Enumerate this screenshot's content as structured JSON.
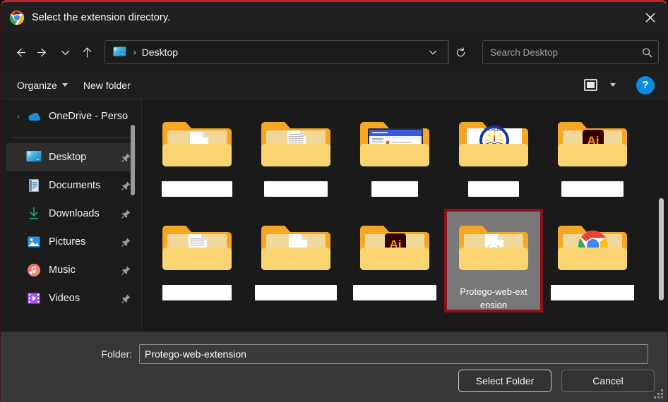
{
  "window": {
    "title": "Select the extension directory.",
    "app_icon": "chrome-icon",
    "close_label": "×",
    "accent_border": "#c0272d"
  },
  "nav": {
    "back": "back-arrow",
    "forward": "forward-arrow",
    "recent": "chevron-down",
    "up": "up-arrow",
    "refresh": "refresh-icon",
    "address": {
      "icon": "desktop-icon",
      "separator": "›",
      "crumb": "Desktop",
      "dropdown": "chevron-down"
    },
    "search": {
      "placeholder": "Search Desktop",
      "value": "",
      "icon": "search-icon"
    }
  },
  "command_bar": {
    "organize": "Organize",
    "new_folder": "New folder",
    "view_icon": "large-icons-view-icon",
    "view_caret": "chevron-down-icon",
    "help": "?"
  },
  "sidebar": {
    "tree_items": [
      {
        "label": "OneDrive - Perso",
        "icon": "onedrive-icon",
        "expander": "›",
        "pinned": false,
        "selected": false
      }
    ],
    "quick_access": [
      {
        "label": "Desktop",
        "icon": "desktop-icon",
        "pinned": true,
        "selected": true
      },
      {
        "label": "Documents",
        "icon": "documents-icon",
        "pinned": true,
        "selected": false
      },
      {
        "label": "Downloads",
        "icon": "downloads-icon",
        "pinned": true,
        "selected": false
      },
      {
        "label": "Pictures",
        "icon": "pictures-icon",
        "pinned": true,
        "selected": false
      },
      {
        "label": "Music",
        "icon": "music-icon",
        "pinned": true,
        "selected": false
      },
      {
        "label": "Videos",
        "icon": "videos-icon",
        "pinned": true,
        "selected": false
      }
    ]
  },
  "file_grid": {
    "items": [
      {
        "label": "",
        "redacted": true,
        "width_class": "w1",
        "icon": "folder-doc-icon",
        "selected": false
      },
      {
        "label": "",
        "redacted": true,
        "width_class": "w2",
        "icon": "folder-lines-icon",
        "selected": false
      },
      {
        "label": "",
        "redacted": true,
        "width_class": "w3",
        "icon": "folder-browser-icon",
        "selected": false
      },
      {
        "label": "",
        "redacted": true,
        "width_class": "w4",
        "icon": "folder-school-icon",
        "selected": false
      },
      {
        "label": "",
        "redacted": true,
        "width_class": "w5",
        "icon": "folder-ai-icon",
        "selected": false
      },
      {
        "label": "",
        "redacted": true,
        "width_class": "w6",
        "icon": "folder-lines-red-icon",
        "selected": false
      },
      {
        "label": "",
        "redacted": true,
        "width_class": "w7",
        "icon": "folder-doc-icon",
        "selected": false
      },
      {
        "label": "",
        "redacted": true,
        "width_class": "w8",
        "icon": "folder-ai-icon",
        "selected": false
      },
      {
        "label": "Protego-web-extension",
        "redacted": false,
        "width_class": "",
        "icon": "folder-code-icon",
        "selected": true
      },
      {
        "label": "",
        "redacted": true,
        "width_class": "w9",
        "icon": "folder-chrome-icon",
        "selected": false
      }
    ],
    "selected_name": "Protego-web-extension"
  },
  "footer": {
    "folder_label": "Folder:",
    "folder_value": "Protego-web-extension",
    "folder_placeholder": "",
    "select_button": "Select Folder",
    "cancel_button": "Cancel",
    "resize_grip": "resize-grip-icon"
  }
}
